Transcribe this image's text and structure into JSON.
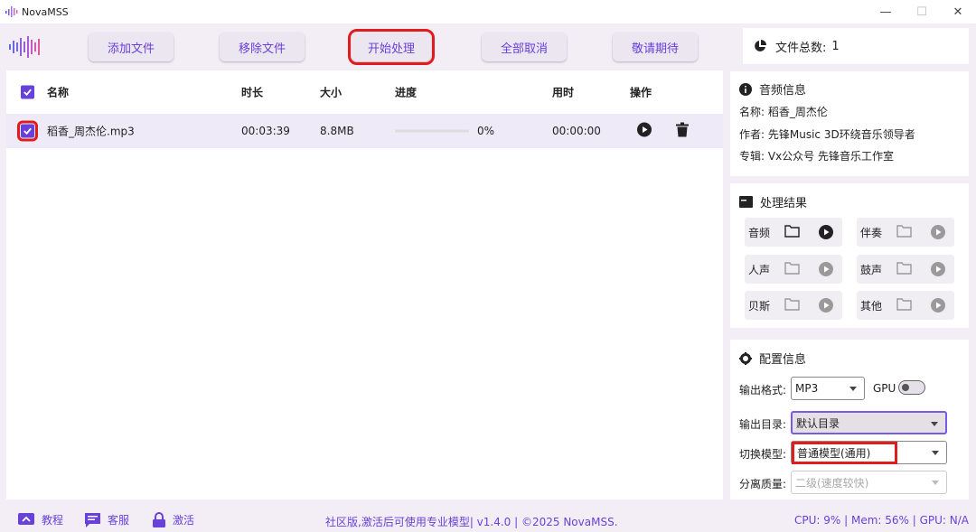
{
  "app": {
    "title": "NovaMSS"
  },
  "window_controls": {
    "minimize": "—",
    "maximize": "☐",
    "close": "✕"
  },
  "toolbar": {
    "add_files": "添加文件",
    "remove_files": "移除文件",
    "start_processing": "开始处理",
    "cancel_all": "全部取消",
    "coming_soon": "敬请期待"
  },
  "file_count": {
    "label": "文件总数:",
    "value": "1"
  },
  "file_list": {
    "headers": {
      "name": "名称",
      "duration": "时长",
      "size": "大小",
      "progress": "进度",
      "elapsed": "用时",
      "actions": "操作"
    },
    "rows": [
      {
        "name": "稻香_周杰伦.mp3",
        "duration": "00:03:39",
        "size": "8.8MB",
        "progress_text": "0%",
        "progress_value": 0,
        "elapsed": "00:00:00",
        "checked": true
      }
    ]
  },
  "audio_info": {
    "title": "音频信息",
    "name_line": "名称:  稻香_周杰伦",
    "author_line": "作者:  先锋Music 3D环绕音乐领导者",
    "album_line": "专辑:  Vx公众号 先锋音乐工作室"
  },
  "results": {
    "title": "处理结果",
    "items": [
      "音频",
      "伴奏",
      "人声",
      "鼓声",
      "贝斯",
      "其他"
    ]
  },
  "config": {
    "title": "配置信息",
    "format_label": "输出格式:",
    "format_value": "MP3",
    "gpu_label": "GPU",
    "gpu_enabled": false,
    "outdir_label": "输出目录:",
    "outdir_value": "默认目录",
    "model_label": "切换模型:",
    "model_value": "普通模型(通用)",
    "quality_label": "分离质量:",
    "quality_value": "二级(速度较快)"
  },
  "statusbar": {
    "tutorial": "教程",
    "support": "客服",
    "activate": "激活",
    "center_text": "社区版,激活后可使用专业模型| v1.4.0 | ©2025 NovaMSS.",
    "system_text": "CPU: 9% | Mem: 56% | GPU: N/A"
  },
  "colors": {
    "accent": "#6741d9",
    "highlight": "#e01c1c",
    "background": "#f3eef6"
  }
}
